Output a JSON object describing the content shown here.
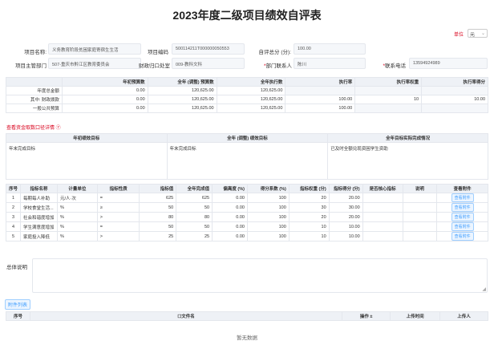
{
  "title": "2023年度二级项目绩效自评表",
  "unit": {
    "label": "单位",
    "value": "元"
  },
  "fields": {
    "project_name": {
      "label": "项目名称:",
      "value": "义务教育阶段贫困家庭寄宿生生活"
    },
    "project_code": {
      "label": "项目编码",
      "value": "500114211T000000050553"
    },
    "self_score": {
      "label": "自评总分 (分):",
      "value": "100.00"
    },
    "dept": {
      "label": "项目主管部门",
      "value": "507-重庆市黔江区教育委员会"
    },
    "finance_office": {
      "label": "财政归口处室",
      "value": "009-教科文科"
    },
    "contact": {
      "label": "部门联系人",
      "req": "*",
      "value": "陈川"
    },
    "phone": {
      "label": "联系电话",
      "req": "*",
      "value": "13594924989"
    }
  },
  "budget": {
    "headers": [
      "",
      "年初预算数",
      "全年 (调整) 预算数",
      "全年执行数",
      "执行率",
      "执行率权重",
      "执行率得分"
    ],
    "rows": [
      [
        "年度总金额",
        "0.00",
        "120,625.00",
        "120,625.00",
        "",
        "",
        ""
      ],
      [
        "其中: 财政拨款",
        "0.00",
        "120,625.00",
        "120,625.00",
        "100.00",
        "10",
        "10.00"
      ],
      [
        "一般公共预算",
        "0.00",
        "120,625.00",
        "120,625.00",
        "100.00",
        "",
        ""
      ]
    ]
  },
  "link_text": "查看资金取数口径详情 ⑦",
  "goals": {
    "headers": [
      "年初绩效目标",
      "全年 (调整) 绩效目标",
      "全年目标实际完成情况"
    ],
    "values": [
      "年末完成目标",
      "年末完成目标",
      "已及时全额兑现资困学生资助"
    ]
  },
  "indicators": {
    "headers": [
      "序号",
      "指标名称",
      "计量单位",
      "指标性质",
      "指标值",
      "全年完成值",
      "偏离度 (%)",
      "得分系数 (%)",
      "指标权重 (分)",
      "指标得分 (分)",
      "是否核心指标",
      "说明",
      "查看附件"
    ],
    "attach_label": "查看附件",
    "rows": [
      [
        "1",
        "每期每人补助",
        "元/人·次",
        "=",
        "625",
        "625",
        "0.00",
        "100",
        "20",
        "20.00"
      ],
      [
        "2",
        "学校食堂生活...",
        "%",
        "≥",
        "50",
        "50",
        "0.00",
        "100",
        "30",
        "30.00"
      ],
      [
        "3",
        "社会和谐度增加",
        "%",
        ">",
        "80",
        "80",
        "0.00",
        "100",
        "20",
        "20.00"
      ],
      [
        "4",
        "学生满意度增加",
        "%",
        "=",
        "50",
        "50",
        "0.00",
        "100",
        "10",
        "10.00"
      ],
      [
        "5",
        "家庭投入降低",
        "%",
        ">",
        "25",
        "25",
        "0.00",
        "100",
        "10",
        "10.00"
      ]
    ]
  },
  "summary": {
    "label": "总体说明"
  },
  "attach_list": {
    "button": "附件列表",
    "headers": [
      "序号",
      "文件名",
      "操作",
      "上传时间",
      "上传人"
    ],
    "empty": "暂无数据"
  }
}
